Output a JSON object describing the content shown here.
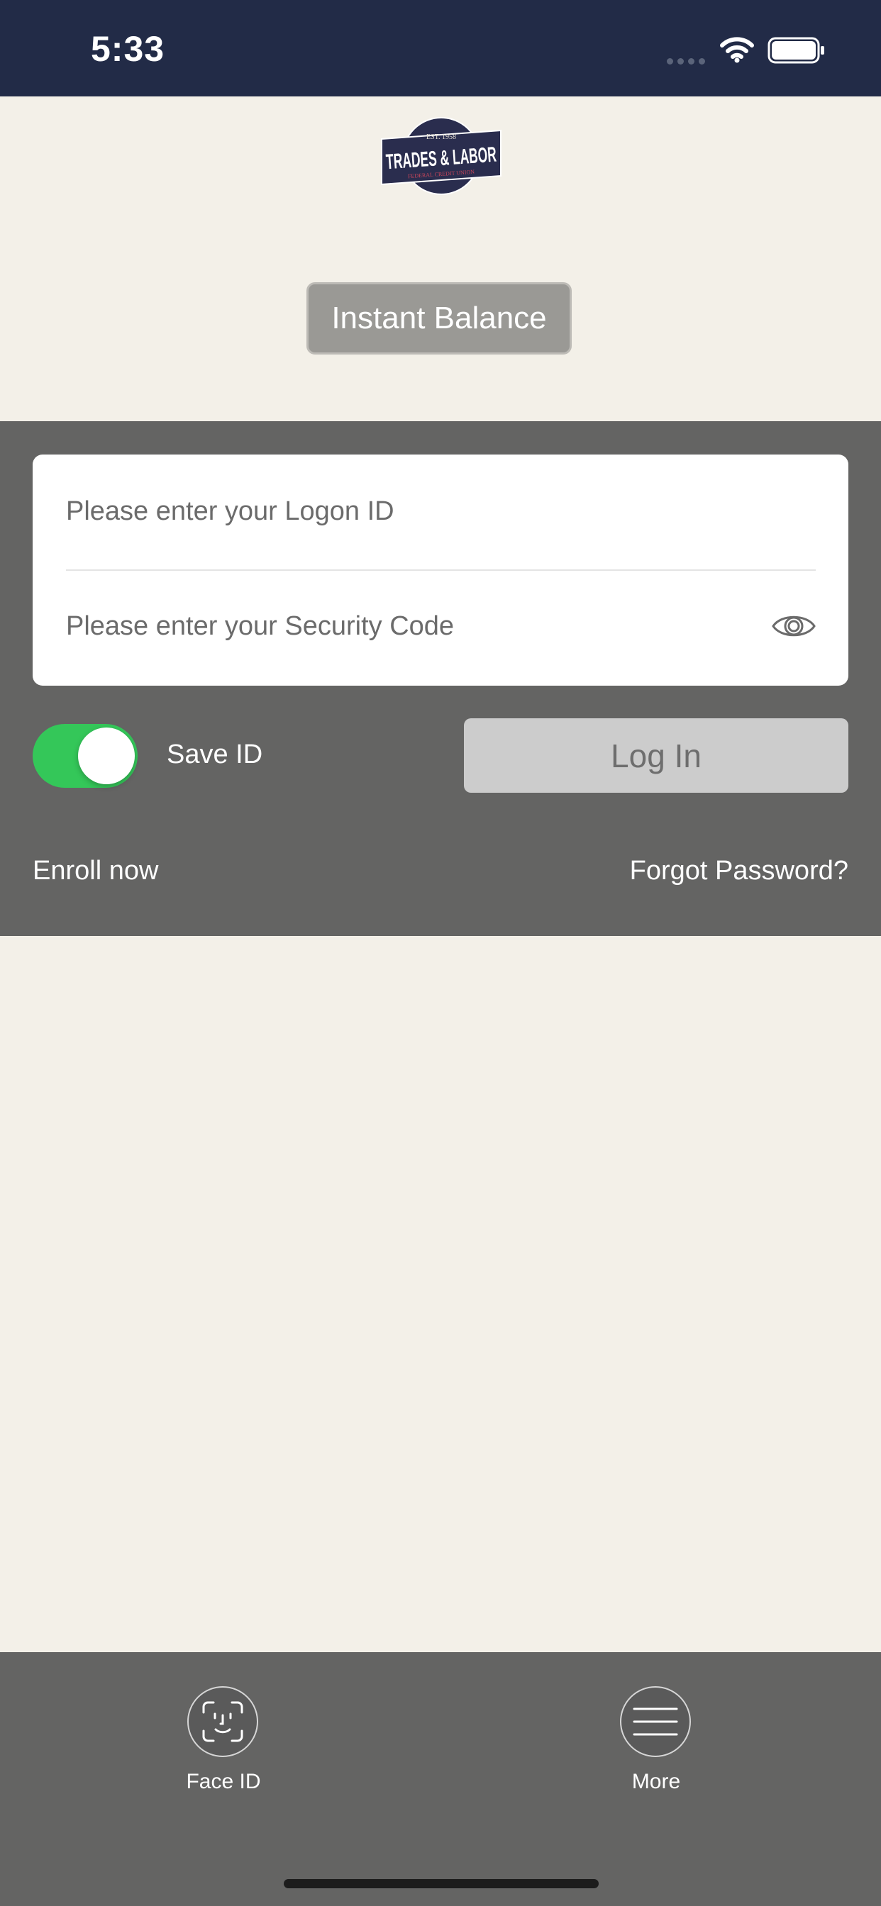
{
  "status_bar": {
    "time": "5:33",
    "icons": [
      "signal-icon",
      "wifi-icon",
      "battery-icon"
    ]
  },
  "logo": {
    "name": "trades-labor-logo",
    "text_top": "EST. 1958",
    "text_main": "TRADES & LABOR",
    "text_bottom": "FEDERAL CREDIT UNION"
  },
  "instant_balance": {
    "label": "Instant Balance"
  },
  "login_form": {
    "logon_id_placeholder": "Please enter your Logon ID",
    "security_code_placeholder": "Please enter your Security Code",
    "save_id_label": "Save ID",
    "save_id_on": true,
    "login_label": "Log In",
    "enroll_label": "Enroll now",
    "forgot_label": "Forgot Password?"
  },
  "bottom_bar": {
    "face_id_label": "Face ID",
    "more_label": "More"
  },
  "colors": {
    "status_bar_bg": "#222b47",
    "page_bg": "#f3f0e8",
    "panel_bg": "#646463",
    "toggle_on": "#34c759",
    "login_button_bg": "#cccccc",
    "logo_navy": "#2a2d4e"
  }
}
